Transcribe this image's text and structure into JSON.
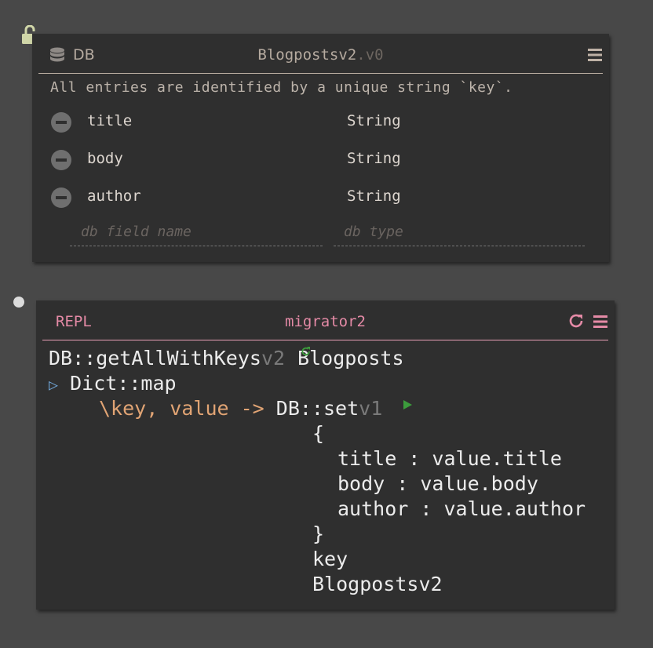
{
  "db": {
    "label": "DB",
    "name": "Blogpostsv2",
    "version": ".v0",
    "description": "All entries are identified by a unique string `key`.",
    "fields": [
      {
        "name": "title",
        "type": "String"
      },
      {
        "name": "body",
        "type": "String"
      },
      {
        "name": "author",
        "type": "String"
      }
    ],
    "new_field_placeholder": "db field name",
    "new_type_placeholder": "db type"
  },
  "repl": {
    "label": "REPL",
    "name": "migrator2",
    "code": {
      "line1_fn": "DB::getAllWithKeys",
      "line1_ver": "v2",
      "line1_arg": "Blogposts",
      "line2_pipe": "▷",
      "line2_fn": "Dict::map",
      "line3_lambda": "\\key, value ->",
      "line3_fn": "DB::set",
      "line3_ver": "v1",
      "open_brace": "{",
      "rec1": "title : value.title",
      "rec2": "body : value.body",
      "rec3": "author : value.author",
      "close_brace": "}",
      "arg_key": "key",
      "arg_table": "Blogpostsv2"
    }
  },
  "colors": {
    "background": "#484848",
    "panel": "#2f2f2f",
    "db_accent": "#b6aba0",
    "repl_accent": "#e48aa6",
    "lambda": "#e1a474",
    "play": "#3c9c3c",
    "lock": "#d0d6a8"
  },
  "icons": [
    "unlock-icon",
    "database-icon",
    "menu-icon",
    "remove-field-icon",
    "refresh-icon",
    "play-icon",
    "pipe-icon"
  ]
}
